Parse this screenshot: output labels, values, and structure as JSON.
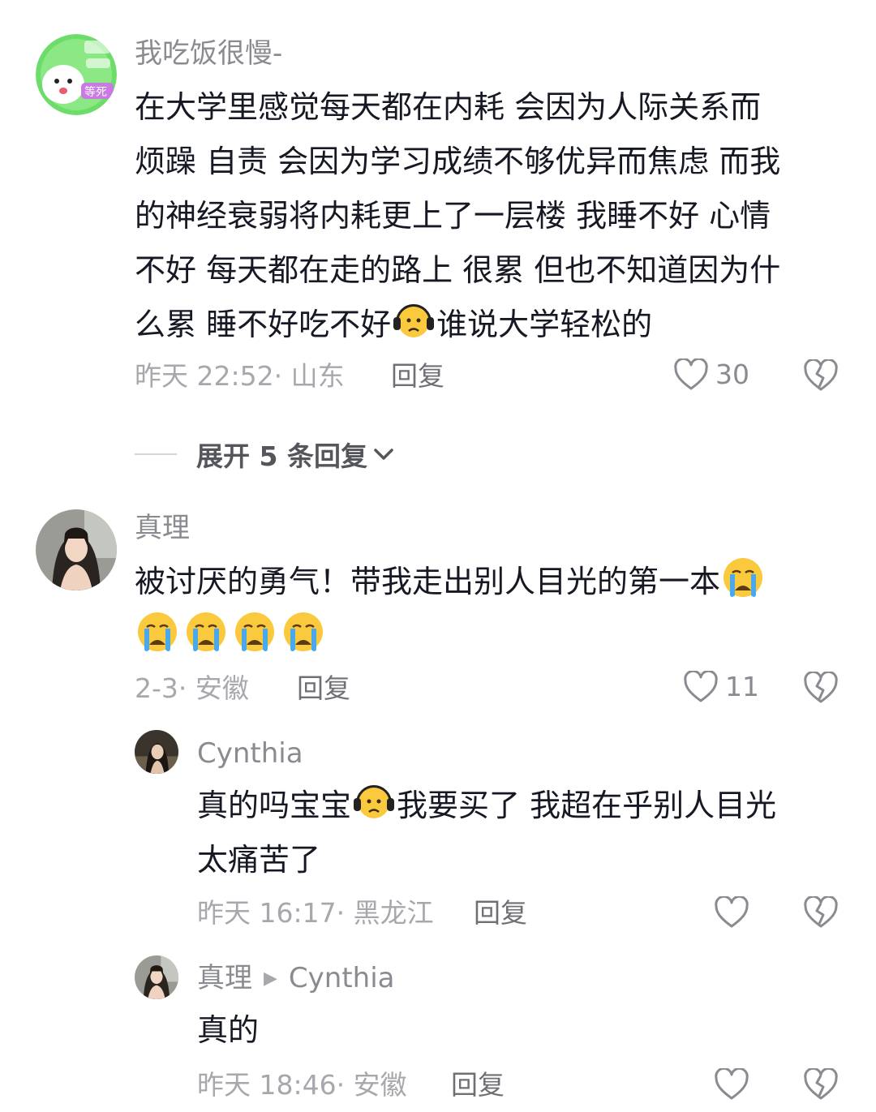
{
  "comments": [
    {
      "username": "我吃饭很慢-",
      "avatar_icon": "cartoon-avatar-icon",
      "text_lines": [
        "在大学里感觉每天都在内耗 会因为人际关系而",
        "烦躁 自责 会因为学习成绩不够优异而焦虑 而我",
        "的神经衰弱将内耗更上了一层楼 我睡不好 心情",
        "不好 每天都在走的路上 很累 但也不知道因为什",
        "么累 睡不好吃不好",
        "谁说大学轻松的"
      ],
      "meta": "昨天 22:52· 山东",
      "reply_label": "回复",
      "likes": "30",
      "expand_label": "展开 5 条回复"
    },
    {
      "username": "真理",
      "avatar_icon": "girl-photo-avatar-icon",
      "text_lines": [
        "被讨厌的勇气！带我走出别人目光的第一本"
      ],
      "meta": "2-3· 安徽",
      "reply_label": "回复",
      "likes": "11"
    }
  ],
  "replies": [
    {
      "username": "Cynthia",
      "avatar_icon": "girl-photo-avatar-icon",
      "text_part1": "真的吗宝宝",
      "text_part2": "我要买了 我超在乎别人目光",
      "text_line2": "太痛苦了",
      "meta": "昨天 16:17· 黑龙江",
      "reply_label": "回复"
    },
    {
      "username": "真理",
      "reply_to": "Cynthia",
      "avatar_icon": "girl-photo-avatar-icon",
      "text": "真的",
      "meta": "昨天 18:46· 安徽",
      "reply_label": "回复"
    }
  ],
  "colors": {
    "username": "#8a8b91",
    "text": "#161823",
    "meta": "#a7a8ad",
    "emoji_face": "#fbc93d",
    "emoji_tear": "#4aa8ec"
  },
  "icons": {
    "like": "heart-outline-icon",
    "dislike": "broken-heart-icon",
    "expand": "chevron-down-icon",
    "emoji_sad": "headphones-frown-emoji",
    "emoji_cry": "crying-face-emoji",
    "reply_arrow": "triangle-right-icon"
  }
}
